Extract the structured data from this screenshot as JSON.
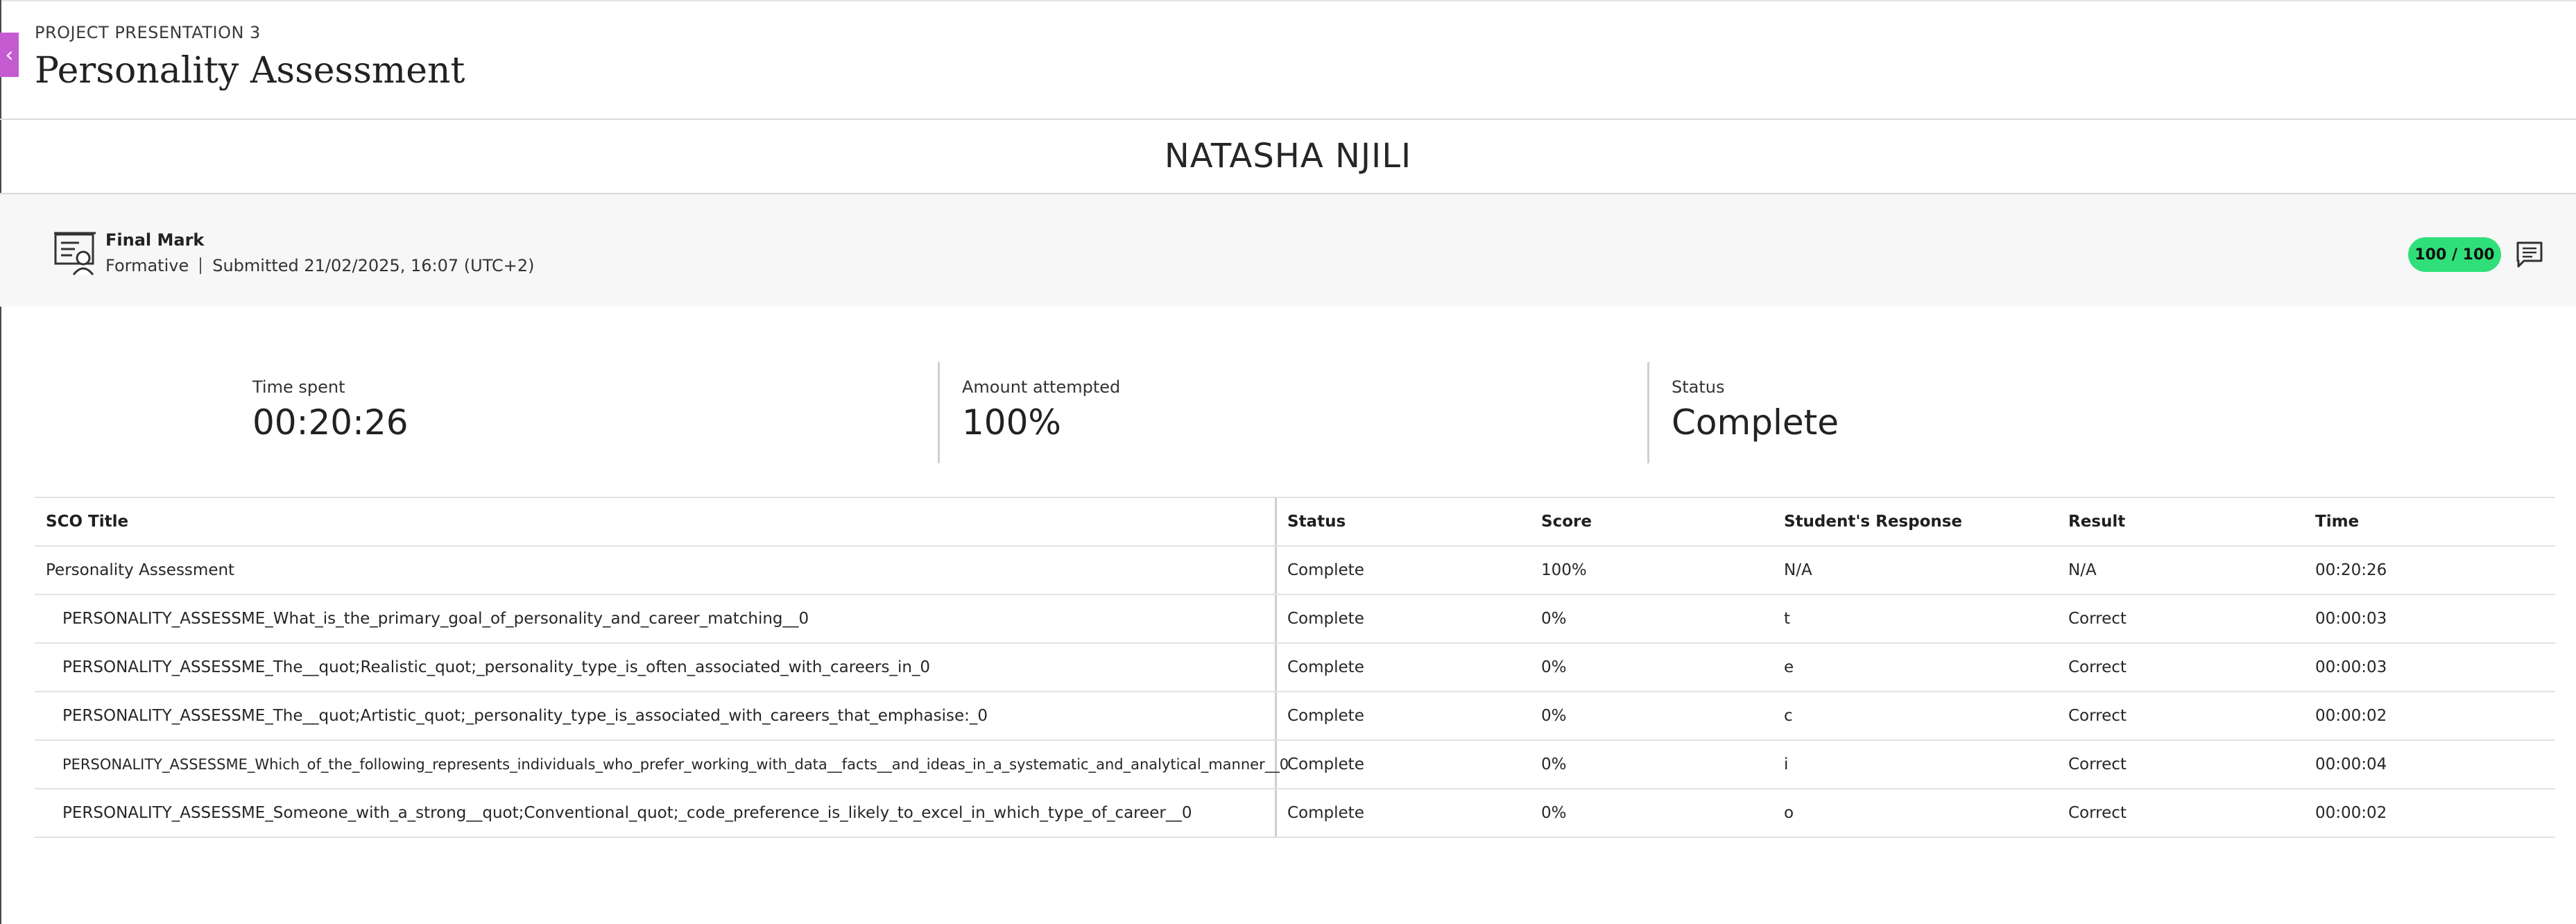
{
  "header": {
    "course": "PROJECT PRESENTATION 3",
    "title": "Personality Assessment"
  },
  "student": {
    "name": "NATASHA NJILI"
  },
  "grade": {
    "label": "Final Mark",
    "type": "Formative",
    "submitted": "Submitted 21/02/2025, 16:07 (UTC+2)",
    "score": "100 / 100",
    "score_color": "#2fe07a"
  },
  "stats": [
    {
      "label": "Time spent",
      "value": "00:20:26"
    },
    {
      "label": "Amount attempted",
      "value": "100%"
    },
    {
      "label": "Status",
      "value": "Complete"
    }
  ],
  "table": {
    "columns": [
      "SCO Title",
      "Status",
      "Score",
      "Student's Response",
      "Result",
      "Time"
    ],
    "rows": [
      {
        "title": "Personality Assessment",
        "status": "Complete",
        "score": "100%",
        "response": "N/A",
        "result": "N/A",
        "time": "00:20:26"
      },
      {
        "title": "PERSONALITY_ASSESSME_What_is_the_primary_goal_of_personality_and_career_matching__0",
        "status": "Complete",
        "score": "0%",
        "response": "t",
        "result": "Correct",
        "time": "00:00:03"
      },
      {
        "title": "PERSONALITY_ASSESSME_The__quot;Realistic_quot;_personality_type_is_often_associated_with_careers_in_0",
        "status": "Complete",
        "score": "0%",
        "response": "e",
        "result": "Correct",
        "time": "00:00:03"
      },
      {
        "title": "PERSONALITY_ASSESSME_The__quot;Artistic_quot;_personality_type_is_associated_with_careers_that_emphasise:_0",
        "status": "Complete",
        "score": "0%",
        "response": "c",
        "result": "Correct",
        "time": "00:00:02"
      },
      {
        "title": "PERSONALITY_ASSESSME_Which_of_the_following_represents_individuals_who_prefer_working_with_data__facts__and_ideas_in_a_systematic_and_analytical_manner__0",
        "status": "Complete",
        "score": "0%",
        "response": "i",
        "result": "Correct",
        "time": "00:00:04"
      },
      {
        "title": "PERSONALITY_ASSESSME_Someone_with_a_strong__quot;Conventional_quot;_code_preference_is_likely_to_excel_in_which_type_of_career__0",
        "status": "Complete",
        "score": "0%",
        "response": "o",
        "result": "Correct",
        "time": "00:00:02"
      }
    ]
  }
}
